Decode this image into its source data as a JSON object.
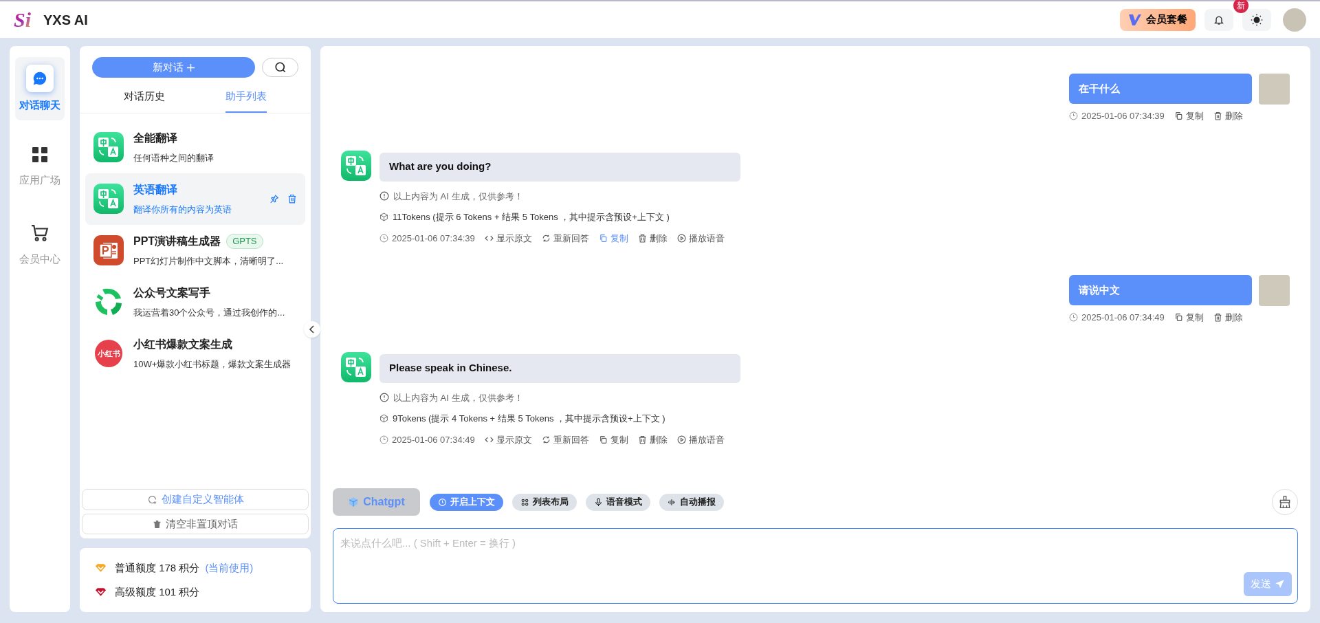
{
  "header": {
    "logo_mark": "Si",
    "title": "YXS AI",
    "vip_button": "会员套餐",
    "notification_badge": "新"
  },
  "nav": [
    {
      "label": "对话聊天",
      "kind": "chat",
      "selected": true
    },
    {
      "label": "应用广场",
      "kind": "grid",
      "selected": false
    },
    {
      "label": "会员中心",
      "kind": "cart",
      "selected": false
    }
  ],
  "panel": {
    "new_chat": "新对话",
    "tabs": [
      {
        "label": "对话历史",
        "selected": false
      },
      {
        "label": "助手列表",
        "selected": true
      }
    ],
    "assistants": [
      {
        "name": "全能翻译",
        "description": "任何语种之间的翻译",
        "kind": "translate",
        "selected": false
      },
      {
        "name": "英语翻译",
        "description": "翻译你所有的内容为英语",
        "kind": "translate",
        "selected": true
      },
      {
        "name": "PPT演讲稿生成器",
        "badge": "GPTS",
        "description": "PPT幻灯片制作中文脚本，清晰明了...",
        "kind": "ppt",
        "selected": false
      },
      {
        "name": "公众号文案写手",
        "description": "我运营着30个公众号，通过我创作的...",
        "kind": "swirl",
        "selected": false
      },
      {
        "name": "小红书爆款文案生成",
        "description": "10W+爆款小红书标题，爆款文案生成器",
        "kind": "redbook",
        "icon_text": "小红书",
        "selected": false
      }
    ],
    "create_button": "创建自定义智能体",
    "clear_button": "清空非置顶对话"
  },
  "quota": [
    {
      "kind": "normal",
      "label": "普通额度 178 积分",
      "note": "(当前使用)"
    },
    {
      "kind": "premium",
      "label": "高级额度 101 积分"
    }
  ],
  "messages": [
    {
      "kind": "user",
      "text": "在干什么",
      "time": "2025-01-06 07:34:39",
      "actions": [
        {
          "kind": "copy",
          "label": "复制",
          "highlighted": false
        },
        {
          "kind": "delete",
          "label": "删除",
          "highlighted": false
        }
      ]
    },
    {
      "kind": "ai",
      "text": "What are you doing?",
      "disclaimer": "以上内容为 AI 生成，仅供参考！",
      "tokens": "11Tokens (提示 6 Tokens + 结果 5 Tokens ，其中提示含预设+上下文 )",
      "time": "2025-01-06 07:34:39",
      "actions": [
        {
          "kind": "source",
          "label": "显示原文",
          "highlighted": false
        },
        {
          "kind": "retry",
          "label": "重新回答",
          "highlighted": false
        },
        {
          "kind": "copy",
          "label": "复制",
          "highlighted": true
        },
        {
          "kind": "delete",
          "label": "删除",
          "highlighted": false
        },
        {
          "kind": "play",
          "label": "播放语音",
          "highlighted": false
        }
      ]
    },
    {
      "kind": "user",
      "text": "请说中文",
      "time": "2025-01-06 07:34:49",
      "actions": [
        {
          "kind": "copy",
          "label": "复制",
          "highlighted": false
        },
        {
          "kind": "delete",
          "label": "删除",
          "highlighted": false
        }
      ]
    },
    {
      "kind": "ai",
      "text": "Please speak in Chinese.",
      "disclaimer": "以上内容为 AI 生成，仅供参考！",
      "tokens": "9Tokens (提示 4 Tokens + 结果 5 Tokens ，其中提示含预设+上下文 )",
      "time": "2025-01-06 07:34:49",
      "actions": [
        {
          "kind": "source",
          "label": "显示原文",
          "highlighted": false
        },
        {
          "kind": "retry",
          "label": "重新回答",
          "highlighted": false
        },
        {
          "kind": "copy",
          "label": "复制",
          "highlighted": false
        },
        {
          "kind": "delete",
          "label": "删除",
          "highlighted": false
        },
        {
          "kind": "play",
          "label": "播放语音",
          "highlighted": false
        }
      ]
    }
  ],
  "toolbar": {
    "model": "Chatgpt",
    "toggles": [
      {
        "kind": "context",
        "label": "开启上下文",
        "on": true
      },
      {
        "kind": "list",
        "label": "列表布局",
        "on": false
      },
      {
        "kind": "voice",
        "label": "语音模式",
        "on": false
      },
      {
        "kind": "autoplay",
        "label": "自动播报",
        "on": false
      }
    ]
  },
  "input": {
    "placeholder": "来说点什么吧... ( Shift + Enter = 换行 )",
    "send": "发送"
  }
}
